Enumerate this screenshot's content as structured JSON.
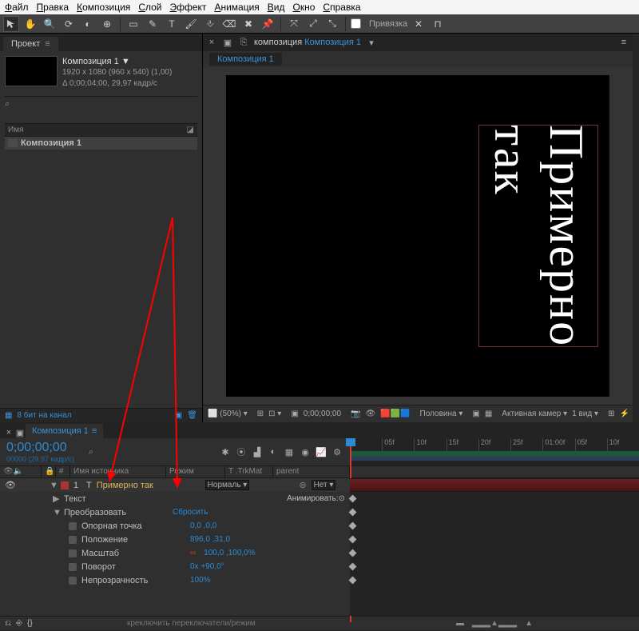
{
  "menu": [
    "Файл",
    "Правка",
    "Композиция",
    "Слой",
    "Эффект",
    "Анимация",
    "Вид",
    "Окно",
    "Справка"
  ],
  "toolbar": {
    "snap_label": "Привязка"
  },
  "project": {
    "panel_title": "Проект",
    "comp_name": "Композиция 1",
    "comp_dims": "1920 x 1080   (960 x 540) (1,00)",
    "comp_dur": "Δ 0;00;04;00, 29,97 кадр/с",
    "search_placeholder": "",
    "col_name": "Имя",
    "footer_bpc": "8 бит на канал"
  },
  "preview": {
    "breadcrumb_prefix": "композиция",
    "breadcrumb_current": "Композиция 1",
    "subtab": "Композиция 1",
    "canvas_text": "Примерно так",
    "footer": {
      "zoom": "(50%)",
      "time": "0;00;00;00",
      "quality": "Половина",
      "camera": "Активная камер",
      "views": "1 вид"
    }
  },
  "timeline": {
    "tab": "Композиция 1",
    "timecode": "0;00;00;00",
    "tc_sub": "00000 (29.97 кадр/с)",
    "cols": {
      "num": "#",
      "src": "Имя источника",
      "mode": "Режим",
      "trk": "T  .TrkMat",
      "parent": "parent"
    },
    "layer": {
      "num": "1",
      "name": "Примерно так",
      "mode": "Нормаль",
      "parent": "Нет"
    },
    "groups": {
      "text": "Текст",
      "animate": "Анимировать:",
      "transform": "Преобразовать",
      "reset": "Сбросить"
    },
    "props": {
      "anchor": "Опорная точка",
      "anchor_v": "0,0 ,0,0",
      "position": "Положение",
      "position_v": "896,0 ,31,0",
      "scale": "Масштаб",
      "scale_v": "100,0 ,100,0%",
      "rotation": "Поворот",
      "rotation_v": "0x +90,0°",
      "opacity": "Непрозрачность",
      "opacity_v": "100%"
    },
    "footer_hint": "креключить переключатели/режим",
    "ruler": [
      "",
      "05f",
      "10f",
      "15f",
      "20f",
      "25f",
      "01:00f",
      "05f",
      "10f"
    ]
  }
}
